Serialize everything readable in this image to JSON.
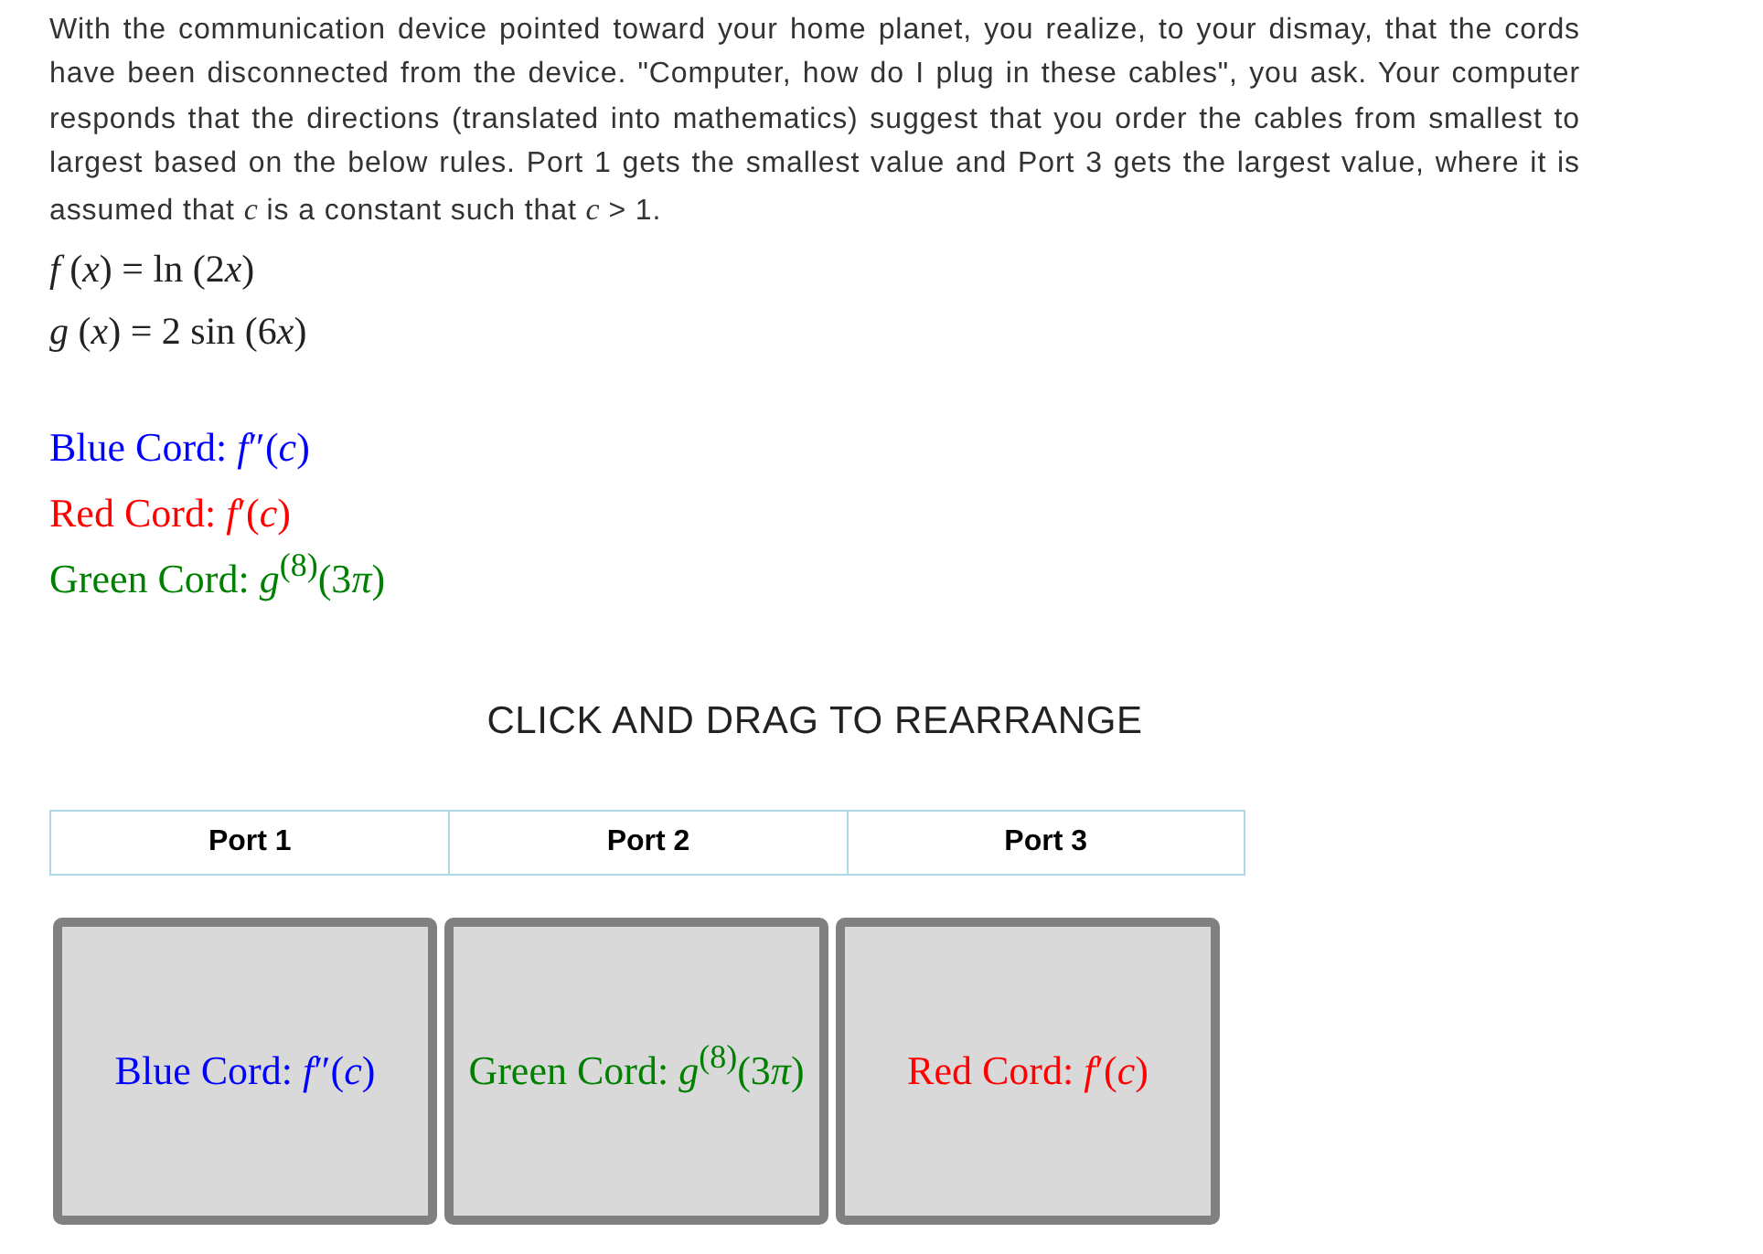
{
  "intro": "With the communication device pointed toward your home planet, you realize, to your dismay, that the cords have been disconnected from the device. \"Computer, how do I plug in these cables\", you ask. Your computer responds that the directions (translated into mathematics) suggest that you order the cables from smallest to largest based on the below rules. Port 1 gets the smallest value and Port 3 gets the largest value, where it is assumed that *c* is a constant such that *c* > 1.",
  "functions": [
    "f (x) = ln (2x)",
    "g (x) = 2 sin (6x)"
  ],
  "cords": [
    {
      "label": "Blue Cord: f″(c)",
      "color": "#0000ff"
    },
    {
      "label": "Red Cord: f′(c)",
      "color": "#ff0000"
    },
    {
      "label": "Green Cord: g$^{(8)}$(3π)",
      "color": "#008000"
    }
  ],
  "instruction": "CLICK AND DRAG TO REARRANGE",
  "ports": [
    "Port 1",
    "Port 2",
    "Port 3"
  ],
  "slots": [
    {
      "label": "Blue Cord: f″(c)",
      "color": "#0000ff"
    },
    {
      "label": "Green Cord: g$^{(8)}$(3π)",
      "color": "#008000"
    },
    {
      "label": "Red Cord: f′(c)",
      "color": "#ff0000"
    }
  ]
}
